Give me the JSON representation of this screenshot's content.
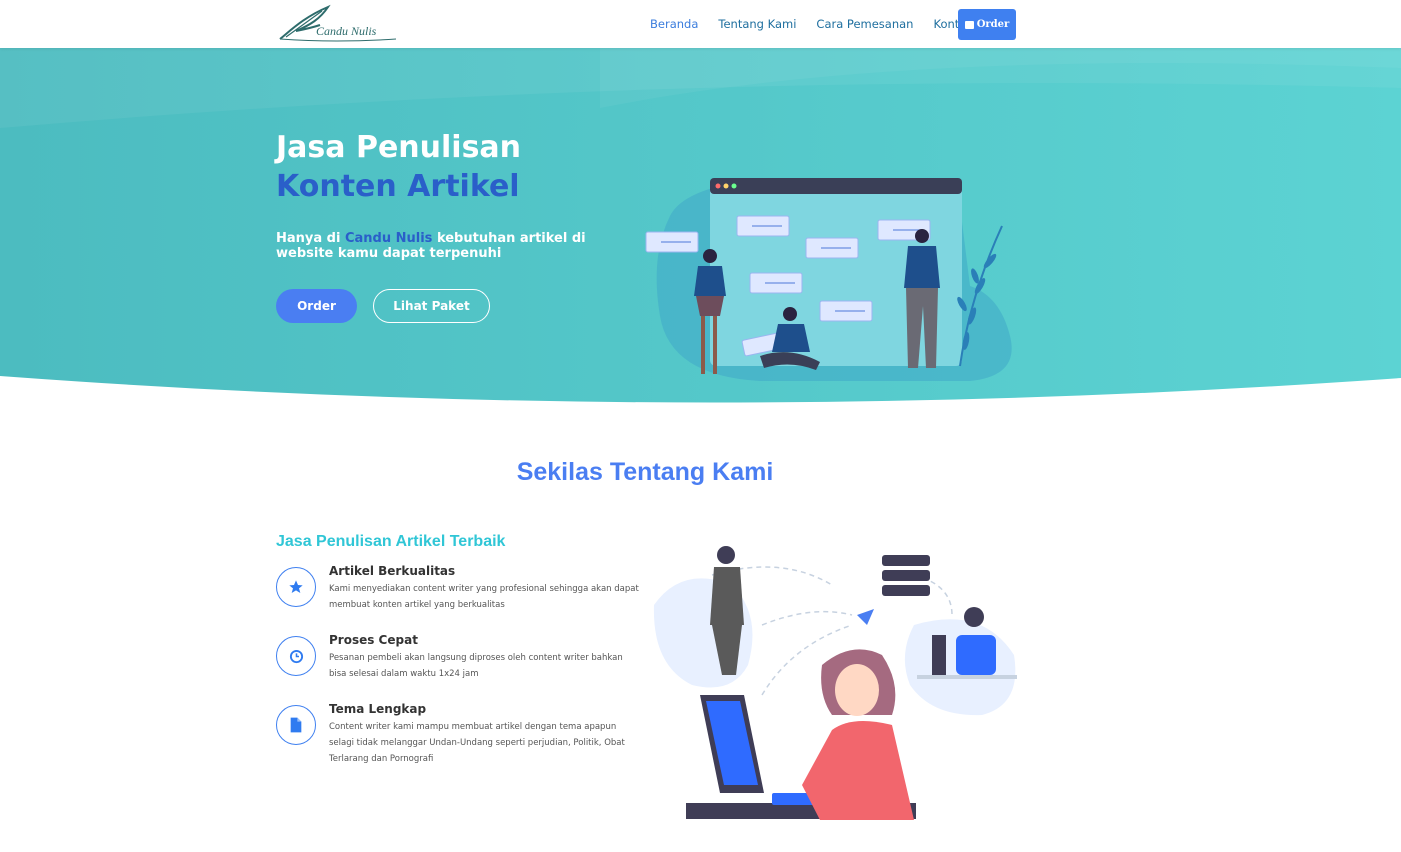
{
  "brand": {
    "logo_text": "Candu Nulis"
  },
  "nav": {
    "items": [
      {
        "label": "Beranda",
        "active": true
      },
      {
        "label": "Tentang Kami",
        "active": false
      },
      {
        "label": "Cara Pemesanan",
        "active": false
      },
      {
        "label": "Kontak",
        "active": false
      }
    ],
    "order_label": "Order",
    "order_icon": "shopping-bag-icon"
  },
  "hero": {
    "title_line1": "Jasa Penulisan",
    "title_line2": "Konten Artikel",
    "subtitle_prefix": "Hanya di ",
    "subtitle_brand": "Candu Nulis",
    "subtitle_suffix": " kebutuhan artikel di website kamu dapat terpenuhi",
    "primary_button": "Order",
    "secondary_button": "Lihat Paket"
  },
  "about": {
    "section_title": "Sekilas Tentang Kami",
    "subtitle": "Jasa Penulisan Artikel Terbaik",
    "features": [
      {
        "title": "Artikel Berkualitas",
        "icon": "star-icon",
        "description": "Kami menyediakan content writer yang profesional sehingga akan dapat membuat konten artikel yang berkualitas"
      },
      {
        "title": "Proses Cepat",
        "icon": "clock-icon",
        "description": "Pesanan pembeli akan langsung diproses oleh content writer bahkan bisa selesai dalam waktu 1x24 jam"
      },
      {
        "title": "Tema Lengkap",
        "icon": "document-icon",
        "description": "Content writer kami mampu membuat artikel dengan tema apapun selagi tidak melanggar Undan-Undang seperti perjudian, Politik, Obat Terlarang dan Pornografi"
      }
    ]
  },
  "colors": {
    "accent": "#4a7ef2",
    "hero_bg": "#4ec8c8",
    "teal_text": "#30c6d6",
    "brand_blue": "#2a5fc9"
  }
}
